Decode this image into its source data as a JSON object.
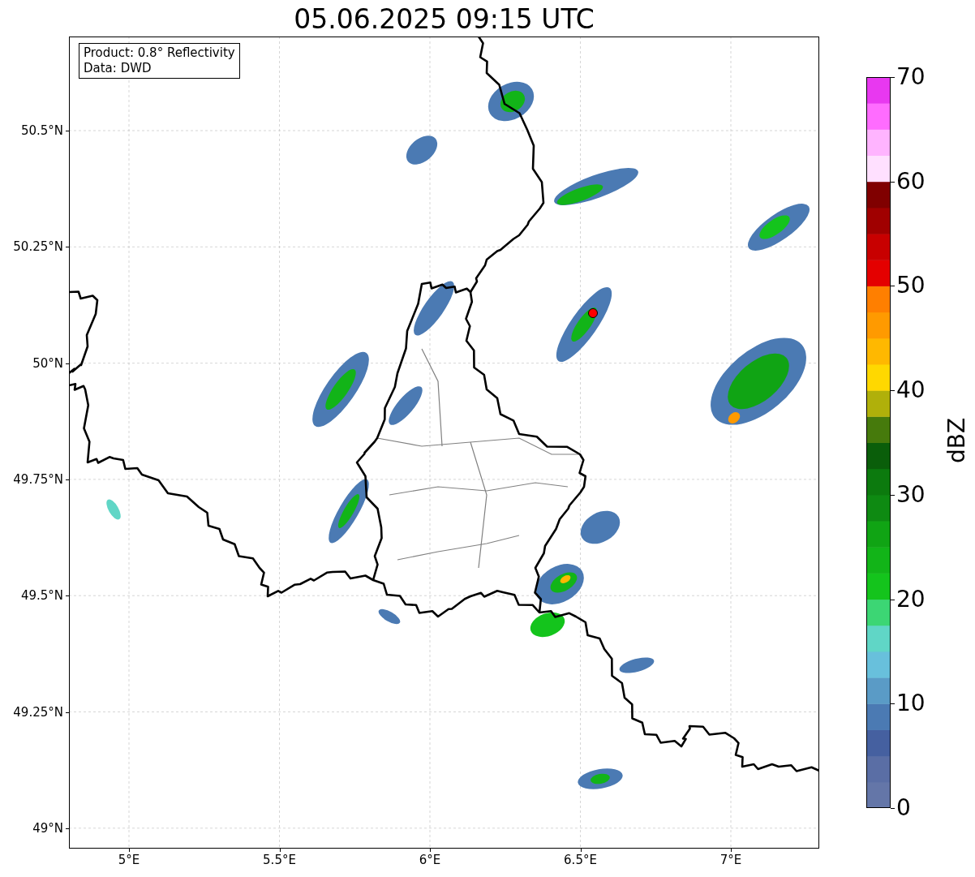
{
  "title": "05.06.2025 09:15 UTC",
  "legend": [
    "Product: 0.8° Reflectivity",
    "Data: DWD"
  ],
  "lat_ticks": [
    "50.5°N",
    "50.25°N",
    "50°N",
    "49.75°N",
    "49.5°N",
    "49.25°N",
    "49°N"
  ],
  "lon_ticks": [
    "5°E",
    "5.5°E",
    "6°E",
    "6.5°E",
    "7°E"
  ],
  "colorbar": {
    "label": "dBZ",
    "ticks": [
      "70",
      "60",
      "50",
      "40",
      "30",
      "20",
      "10",
      "0"
    ]
  }
}
